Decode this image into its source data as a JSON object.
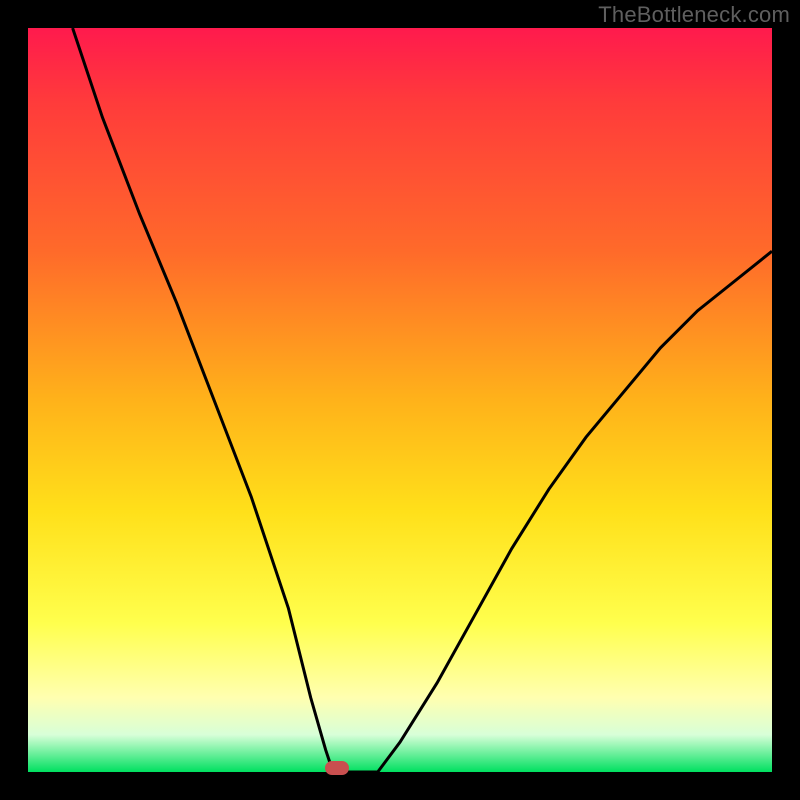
{
  "watermark": "TheBottleneck.com",
  "chart_data": {
    "type": "line",
    "title": "",
    "xlabel": "",
    "ylabel": "",
    "xlim": [
      0,
      100
    ],
    "ylim": [
      0,
      100
    ],
    "grid": false,
    "series": [
      {
        "name": "curve",
        "x": [
          6,
          10,
          15,
          20,
          25,
          30,
          35,
          38,
          40,
          41,
          42,
          47,
          50,
          55,
          60,
          65,
          70,
          75,
          80,
          85,
          90,
          95,
          100
        ],
        "values": [
          100,
          88,
          75,
          63,
          50,
          37,
          22,
          10,
          3,
          0,
          0,
          0,
          4,
          12,
          21,
          30,
          38,
          45,
          51,
          57,
          62,
          66,
          70
        ]
      }
    ],
    "marker": {
      "x": 41.5,
      "y": 0
    },
    "gradient_stops": [
      {
        "pos": 0.0,
        "color": "#ff1a4d"
      },
      {
        "pos": 0.5,
        "color": "#ffb21a"
      },
      {
        "pos": 0.8,
        "color": "#ffff4d"
      },
      {
        "pos": 1.0,
        "color": "#00e060"
      }
    ]
  }
}
